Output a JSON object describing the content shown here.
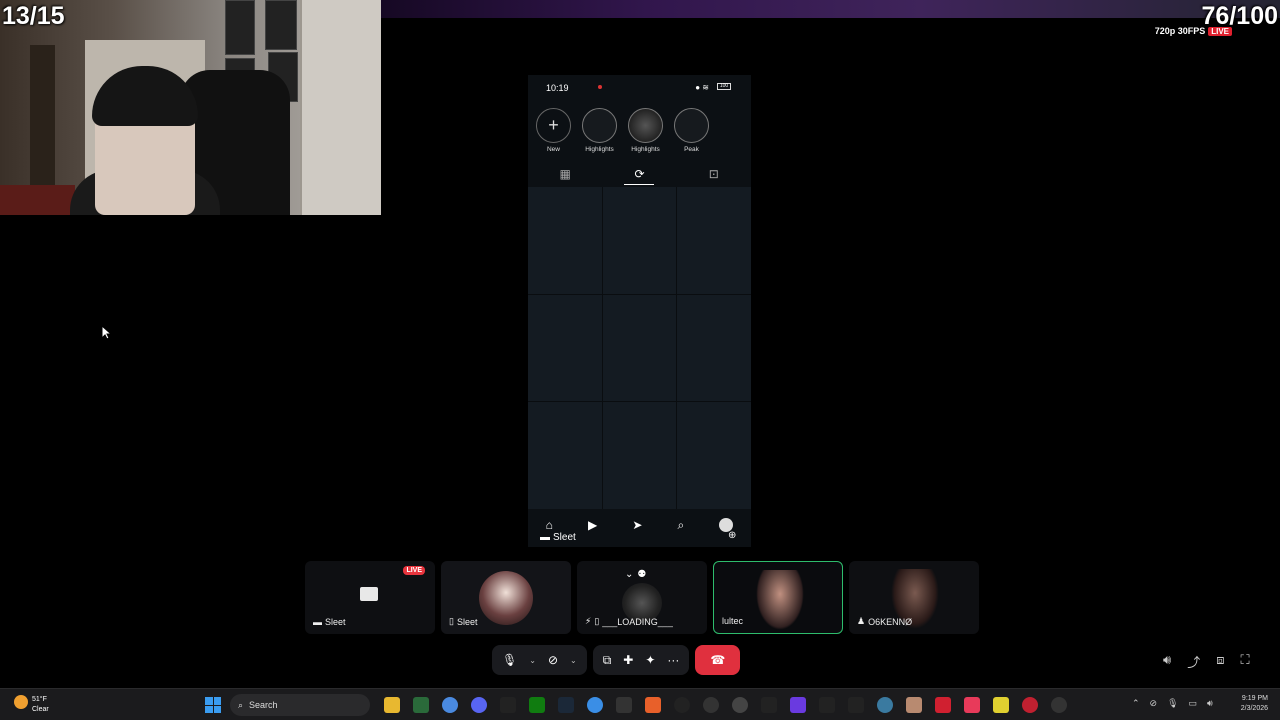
{
  "overlay": {
    "goal_counter_left": "13/15",
    "goal_counter_right": "76/100",
    "stream_quality": "720p 30FPS",
    "live_label": "LIVE"
  },
  "phone": {
    "time": "10:19",
    "battery": "100",
    "highlights": [
      {
        "label": "New",
        "icon": "plus-icon"
      },
      {
        "label": "Highlights",
        "icon": "highlight-icon"
      },
      {
        "label": "Highlights",
        "icon": "highlight-icon"
      },
      {
        "label": "Peak",
        "icon": "highlight-icon"
      }
    ],
    "tabs": [
      "grid-icon",
      "reels-icon",
      "tagged-icon"
    ],
    "nav": [
      "home-icon",
      "reels-icon",
      "send-icon",
      "search-icon",
      "profile-icon"
    ],
    "owner_label": "Sleet"
  },
  "call": {
    "tiles": [
      {
        "name": "Sleet",
        "type": "screen",
        "live": "LIVE"
      },
      {
        "name": "Sleet",
        "type": "avatar"
      },
      {
        "name": "___LOADING___",
        "type": "screen-share"
      },
      {
        "name": "lultec",
        "type": "video"
      },
      {
        "name": "O6KENNØ",
        "type": "avatar"
      }
    ]
  },
  "taskbar": {
    "weather_temp": "51°F",
    "weather_desc": "Clear",
    "search_placeholder": "Search",
    "time": "9:19 PM",
    "date": "2/3/2026"
  },
  "colors": {
    "accent_live": "#e8353e",
    "active_tile_border": "#2ebc6c",
    "hangup": "#e0303e",
    "windows_blue": "#3a9cf0"
  }
}
